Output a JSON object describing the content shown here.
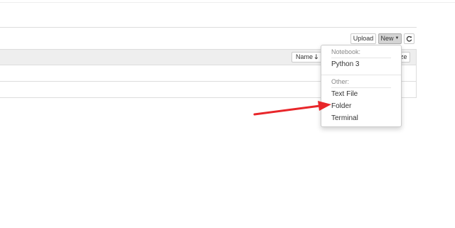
{
  "toolbar": {
    "upload_label": "Upload",
    "new_label": "New",
    "refresh_icon": "refresh-icon"
  },
  "list_header": {
    "name_sort_label": "Name",
    "name_sort_icon": "arrow-down-icon",
    "size_label_fragment": "ze"
  },
  "new_menu": {
    "notebook_header": "Notebook:",
    "notebook_items": [
      "Python 3"
    ],
    "other_header": "Other:",
    "other_items": [
      "Text File",
      "Folder",
      "Terminal"
    ]
  },
  "annotation": {
    "arrow_color": "#e8262a",
    "arrow_target": "Folder"
  }
}
